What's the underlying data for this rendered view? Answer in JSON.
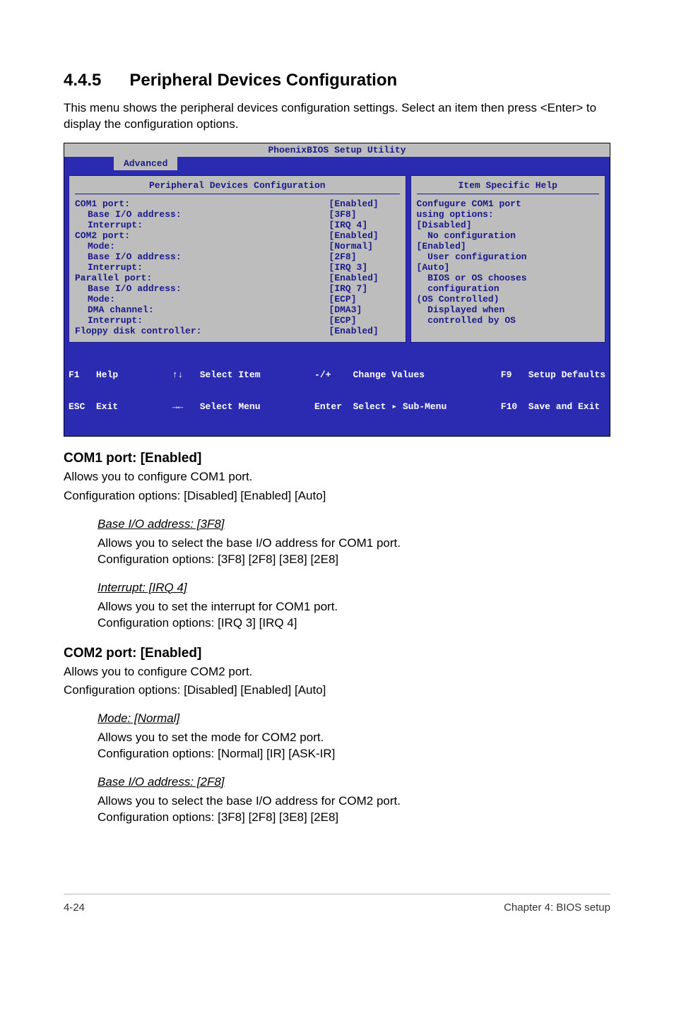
{
  "section": {
    "number": "4.4.5",
    "title": "Peripheral Devices Configuration",
    "intro": "This menu shows the peripheral devices configuration settings. Select an item then press <Enter> to display the configuration options."
  },
  "bios": {
    "title": "PhoenixBIOS Setup Utility",
    "tab": "Advanced",
    "left_header": "Peripheral Devices Configuration",
    "right_header": "Item Specific Help",
    "rows": [
      {
        "label": "COM1 port:",
        "value": "[Enabled]",
        "indent": 0
      },
      {
        "label": "Base I/O address:",
        "value": "[3F8]",
        "indent": 1
      },
      {
        "label": "Interrupt:",
        "value": "[IRQ 4]",
        "indent": 1
      },
      {
        "label": "COM2 port:",
        "value": "[Enabled]",
        "indent": 0
      },
      {
        "label": "Mode:",
        "value": "[Normal]",
        "indent": 1
      },
      {
        "label": "Base I/O address:",
        "value": "[2F8]",
        "indent": 1
      },
      {
        "label": "Interrupt:",
        "value": "[IRQ 3]",
        "indent": 1
      },
      {
        "label": "Parallel port:",
        "value": "[Enabled]",
        "indent": 0
      },
      {
        "label": "Base I/O address:",
        "value": "[IRQ 7]",
        "indent": 1
      },
      {
        "label": "Mode:",
        "value": "[ECP]",
        "indent": 1
      },
      {
        "label": "DMA channel:",
        "value": "[DMA3]",
        "indent": 1
      },
      {
        "label": "Interrupt:",
        "value": "[ECP]",
        "indent": 1
      },
      {
        "label": "Floppy disk controller:",
        "value": "[Enabled]",
        "indent": 0
      }
    ],
    "help_lines": [
      "Confugure COM1 port",
      "using options:",
      "",
      "[Disabled]",
      "  No configuration",
      "",
      "[Enabled]",
      "  User configuration",
      "",
      "[Auto]",
      "  BIOS or OS chooses",
      "  configuration",
      "",
      "(OS Controlled)",
      "  Displayed when",
      "  controlled by OS"
    ],
    "footer": {
      "c1a": "F1   Help",
      "c1b": "ESC  Exit",
      "c2a": "↑↓   Select Item",
      "c2b": "→←   Select Menu",
      "c3a": "-/+    Change Values",
      "c3b": "Enter  Select ▸ Sub-Menu",
      "c4a": "F9   Setup Defaults",
      "c4b": "F10  Save and Exit"
    }
  },
  "com1": {
    "head": "COM1 port: [Enabled]",
    "p1": "Allows you to configure COM1 port.",
    "p2": "Configuration options: [Disabled] [Enabled] [Auto]",
    "sub1": {
      "title": "Base I/O address: [3F8]",
      "p1": "Allows you to select the base I/O address for COM1 port.",
      "p2": "Configuration options: [3F8] [2F8] [3E8] [2E8]"
    },
    "sub2": {
      "title": "Interrupt: [IRQ 4]",
      "p1": "Allows you to set the interrupt for COM1 port.",
      "p2": "Configuration options: [IRQ 3] [IRQ 4]"
    }
  },
  "com2": {
    "head": "COM2 port: [Enabled]",
    "p1": "Allows you to configure COM2 port.",
    "p2": "Configuration options: [Disabled] [Enabled] [Auto]",
    "sub1": {
      "title": "Mode: [Normal]",
      "p1": "Allows you to set the mode for COM2 port.",
      "p2": "Configuration options: [Normal] [IR] [ASK-IR]"
    },
    "sub2": {
      "title": "Base I/O address: [2F8]",
      "p1": "Allows you to select the base I/O address for COM2 port.",
      "p2": "Configuration options: [3F8] [2F8] [3E8] [2E8]"
    }
  },
  "footer": {
    "left": "4-24",
    "right": "Chapter 4: BIOS setup"
  }
}
